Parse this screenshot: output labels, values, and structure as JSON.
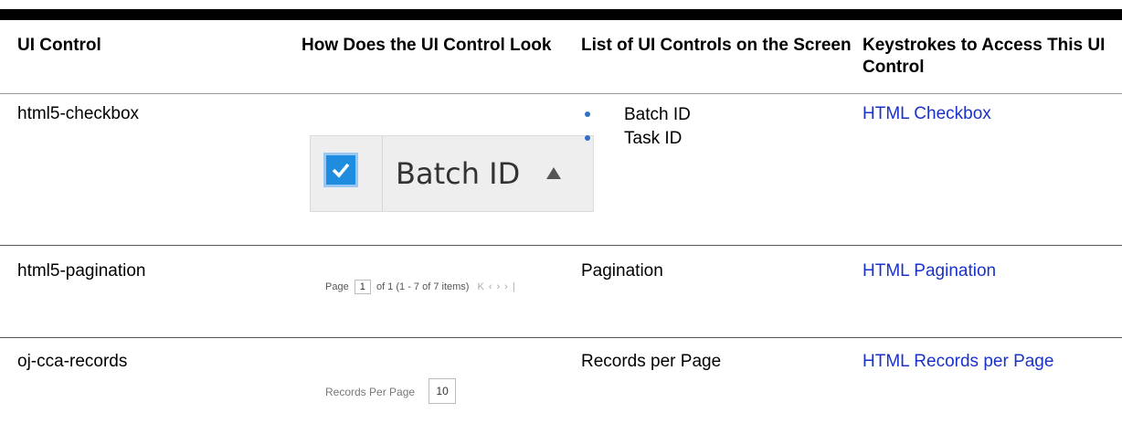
{
  "headers": {
    "col1": "UI Control",
    "col2": "How Does the UI Control Look",
    "col3": "List of UI Controls on the Screen",
    "col4": "Keystrokes to Access This UI Control"
  },
  "rows": [
    {
      "control": "html5-checkbox",
      "list_items": [
        "Batch ID",
        "Task ID"
      ],
      "link": "HTML Checkbox",
      "preview": {
        "label": "Batch ID",
        "checked": true
      }
    },
    {
      "control": "html5-pagination",
      "list_text": "Pagination",
      "link": "HTML Pagination",
      "preview": {
        "page_label": "Page",
        "page_value": "1",
        "of_text": "of 1",
        "items_text": "(1 - 7 of 7 items)"
      }
    },
    {
      "control": "oj-cca-records",
      "list_text": "Records per Page",
      "link": "HTML Records per Page",
      "preview": {
        "label": "Records Per Page",
        "value": "10"
      }
    }
  ],
  "colors": {
    "link": "#1a32c8",
    "bullet": "#2f6fc6",
    "checkbox": "#1e8de0"
  }
}
